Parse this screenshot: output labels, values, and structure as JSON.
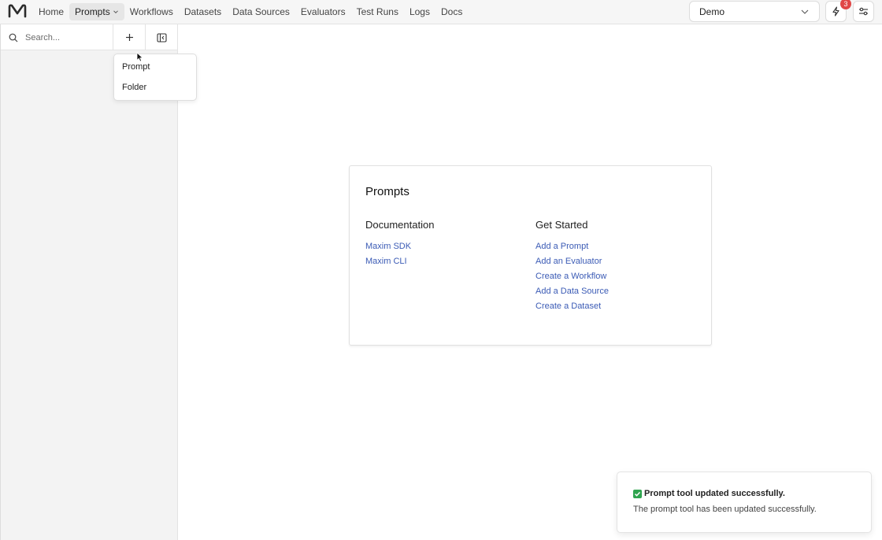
{
  "nav": {
    "items": [
      {
        "label": "Home"
      },
      {
        "label": "Prompts",
        "active": true
      },
      {
        "label": "Workflows"
      },
      {
        "label": "Datasets"
      },
      {
        "label": "Data Sources"
      },
      {
        "label": "Evaluators"
      },
      {
        "label": "Test Runs"
      },
      {
        "label": "Logs"
      },
      {
        "label": "Docs"
      }
    ]
  },
  "workspace": {
    "selected": "Demo"
  },
  "notifications": {
    "count": "3"
  },
  "sidebar": {
    "search_placeholder": "Search...",
    "add_menu": {
      "options": [
        "Prompt",
        "Folder"
      ]
    }
  },
  "card": {
    "title": "Prompts",
    "documentation": {
      "title": "Documentation",
      "links": [
        "Maxim SDK",
        "Maxim CLI"
      ]
    },
    "get_started": {
      "title": "Get Started",
      "links": [
        "Add a Prompt",
        "Add an Evaluator",
        "Create a Workflow",
        "Add a Data Source",
        "Create a Dataset"
      ]
    }
  },
  "toast": {
    "title": "Prompt tool updated successfully.",
    "message": "The prompt tool has been updated successfully."
  },
  "colors": {
    "link": "#3b5bb5",
    "badge": "#e04747",
    "success": "#2fa44f"
  }
}
